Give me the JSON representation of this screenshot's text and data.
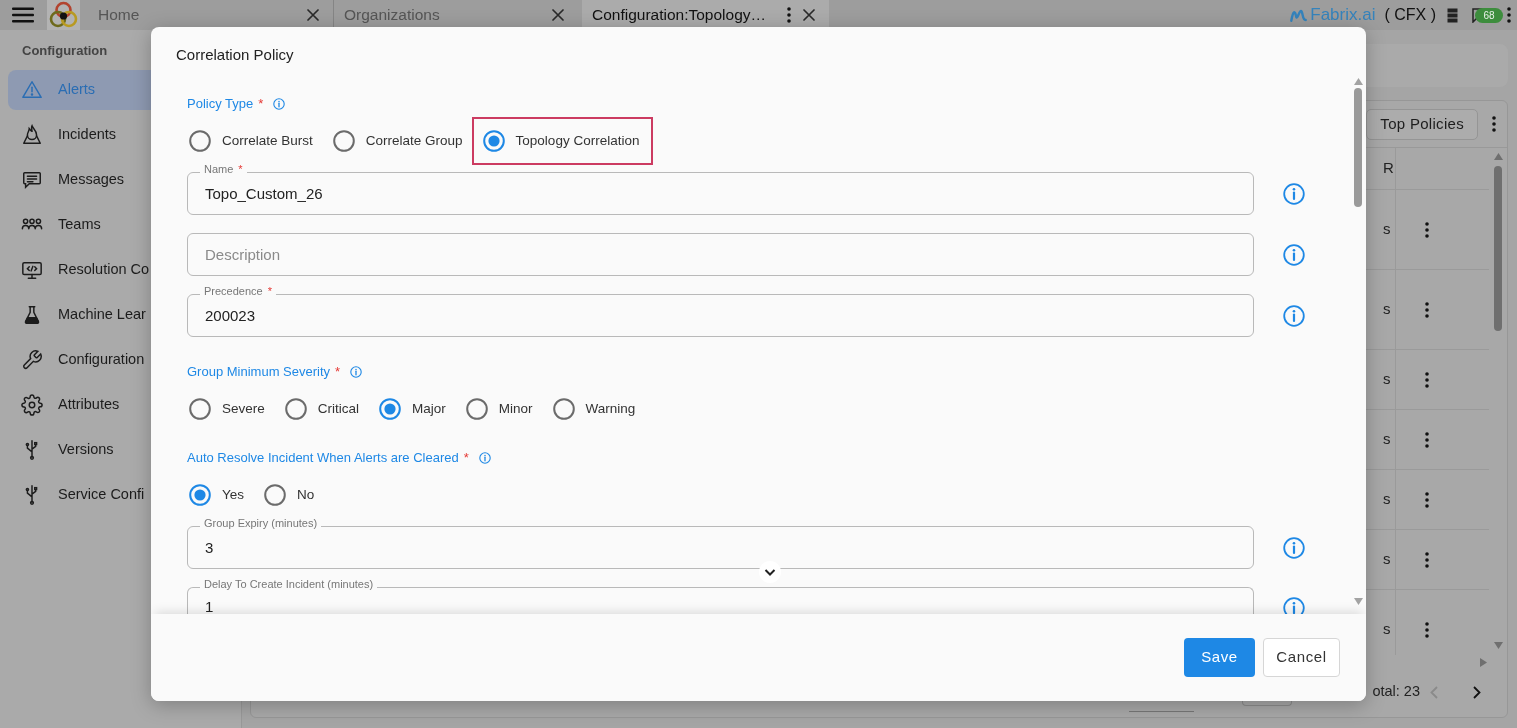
{
  "top_bar": {
    "tabs": [
      {
        "label": "Home",
        "selected": false
      },
      {
        "label": "Organizations",
        "selected": false
      },
      {
        "label": "Configuration:Topology…",
        "selected": true
      }
    ],
    "brand": "Fabrix.ai",
    "tenant": "( CFX )",
    "notification_count": "68"
  },
  "sidebar": {
    "heading": "Configuration",
    "items": [
      {
        "label": "Alerts",
        "selected": true
      },
      {
        "label": "Incidents",
        "selected": false
      },
      {
        "label": "Messages",
        "selected": false
      },
      {
        "label": "Teams",
        "selected": false
      },
      {
        "label": "Resolution Co",
        "selected": false
      },
      {
        "label": "Machine Lear",
        "selected": false
      },
      {
        "label": "Configuration",
        "selected": false
      },
      {
        "label": "Attributes",
        "selected": false
      },
      {
        "label": "Versions",
        "selected": false
      },
      {
        "label": "Service Confi",
        "selected": false
      }
    ]
  },
  "policy_panel": {
    "button": "Top Policies",
    "column_header": "R",
    "rows": [
      {
        "cell": "s"
      },
      {
        "cell": "s"
      },
      {
        "cell": "s"
      },
      {
        "cell": "s"
      },
      {
        "cell": "s"
      },
      {
        "cell": "s"
      },
      {
        "cell": "s"
      }
    ],
    "total": "otal: 23",
    "prev": {
      "disabled": true
    },
    "next": {
      "disabled": false
    }
  },
  "dialog": {
    "title": "Correlation Policy",
    "fields": [
      {
        "kind": "radio_group",
        "label": "Policy Type",
        "required_mark": "*",
        "options": [
          {
            "label": "Correlate Burst",
            "selected": false,
            "highlighted": false
          },
          {
            "label": "Correlate Group",
            "selected": false,
            "highlighted": false
          },
          {
            "label": "Topology Correlation",
            "selected": true,
            "highlighted": true
          }
        ]
      },
      {
        "kind": "text_field",
        "label": "Name",
        "required_mark": "*",
        "value": "Topo_Custom_26"
      },
      {
        "kind": "text_field",
        "placeholder": "Description"
      },
      {
        "kind": "text_field",
        "label": "Precedence",
        "required_mark": "*",
        "value": "200023"
      },
      {
        "kind": "radio_group",
        "label": "Group Minimum Severity",
        "required_mark": "*",
        "options": [
          {
            "label": "Severe",
            "selected": false,
            "highlighted": false
          },
          {
            "label": "Critical",
            "selected": false,
            "highlighted": false
          },
          {
            "label": "Major",
            "selected": true,
            "highlighted": false
          },
          {
            "label": "Minor",
            "selected": false,
            "highlighted": false
          },
          {
            "label": "Warning",
            "selected": false,
            "highlighted": false
          }
        ]
      },
      {
        "kind": "radio_group",
        "label": "Auto Resolve Incident When Alerts are Cleared",
        "required_mark": "*",
        "options": [
          {
            "label": "Yes",
            "selected": true,
            "highlighted": false
          },
          {
            "label": "No",
            "selected": false,
            "highlighted": false
          }
        ]
      },
      {
        "kind": "text_field",
        "label": "Group Expiry (minutes)",
        "value": "3"
      },
      {
        "kind": "text_field",
        "label": "Delay To Create Incident (minutes)",
        "value": "1"
      }
    ],
    "buttons": [
      {
        "label": "Save",
        "kind": "primary"
      },
      {
        "label": "Cancel",
        "kind": "secondary"
      }
    ]
  }
}
